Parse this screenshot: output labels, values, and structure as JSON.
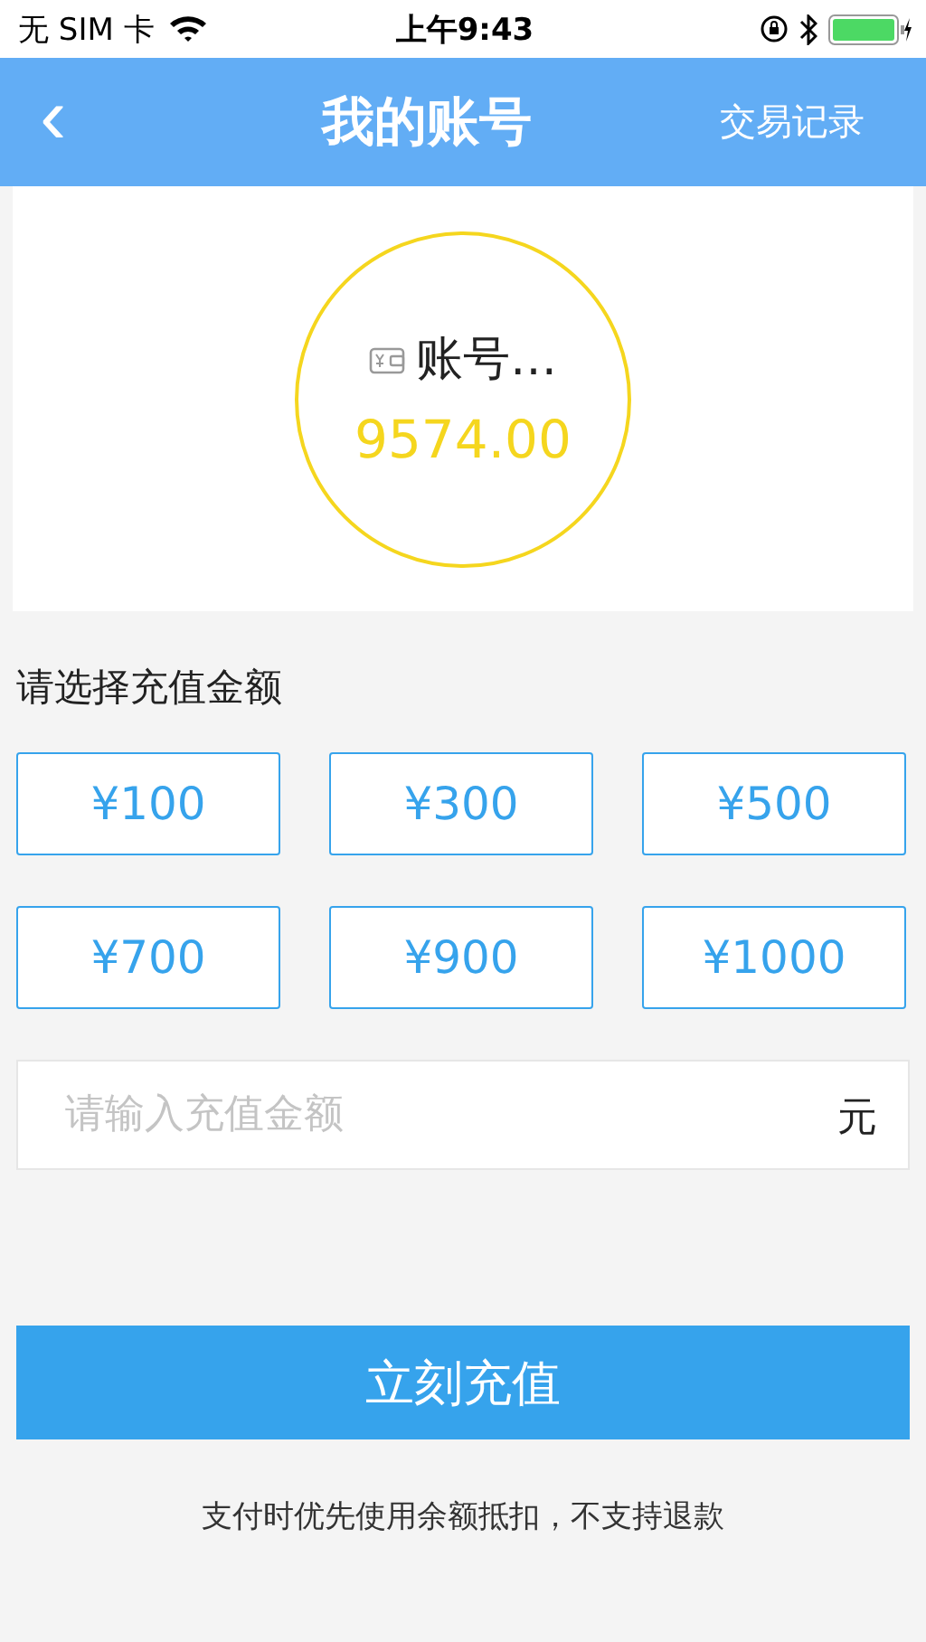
{
  "status_bar": {
    "carrier": "无 SIM 卡",
    "time": "上午9:43"
  },
  "nav": {
    "back": "‹",
    "title": "我的账号",
    "action": "交易记录"
  },
  "account": {
    "name": "账号…",
    "balance": "9574.00"
  },
  "section_title": "请选择充值金额",
  "amounts": [
    {
      "label": "¥100",
      "selected": false
    },
    {
      "label": "¥300",
      "selected": false
    },
    {
      "label": "¥500",
      "selected": false
    },
    {
      "label": "¥700",
      "selected": false
    },
    {
      "label": "¥900",
      "selected": false
    },
    {
      "label": "¥1000",
      "selected": false
    }
  ],
  "amount_field": {
    "placeholder": "请输入充值金额",
    "unit": "元"
  },
  "submit": "立刻充值",
  "note": "支付时优先使用余额抵扣，不支持退款"
}
